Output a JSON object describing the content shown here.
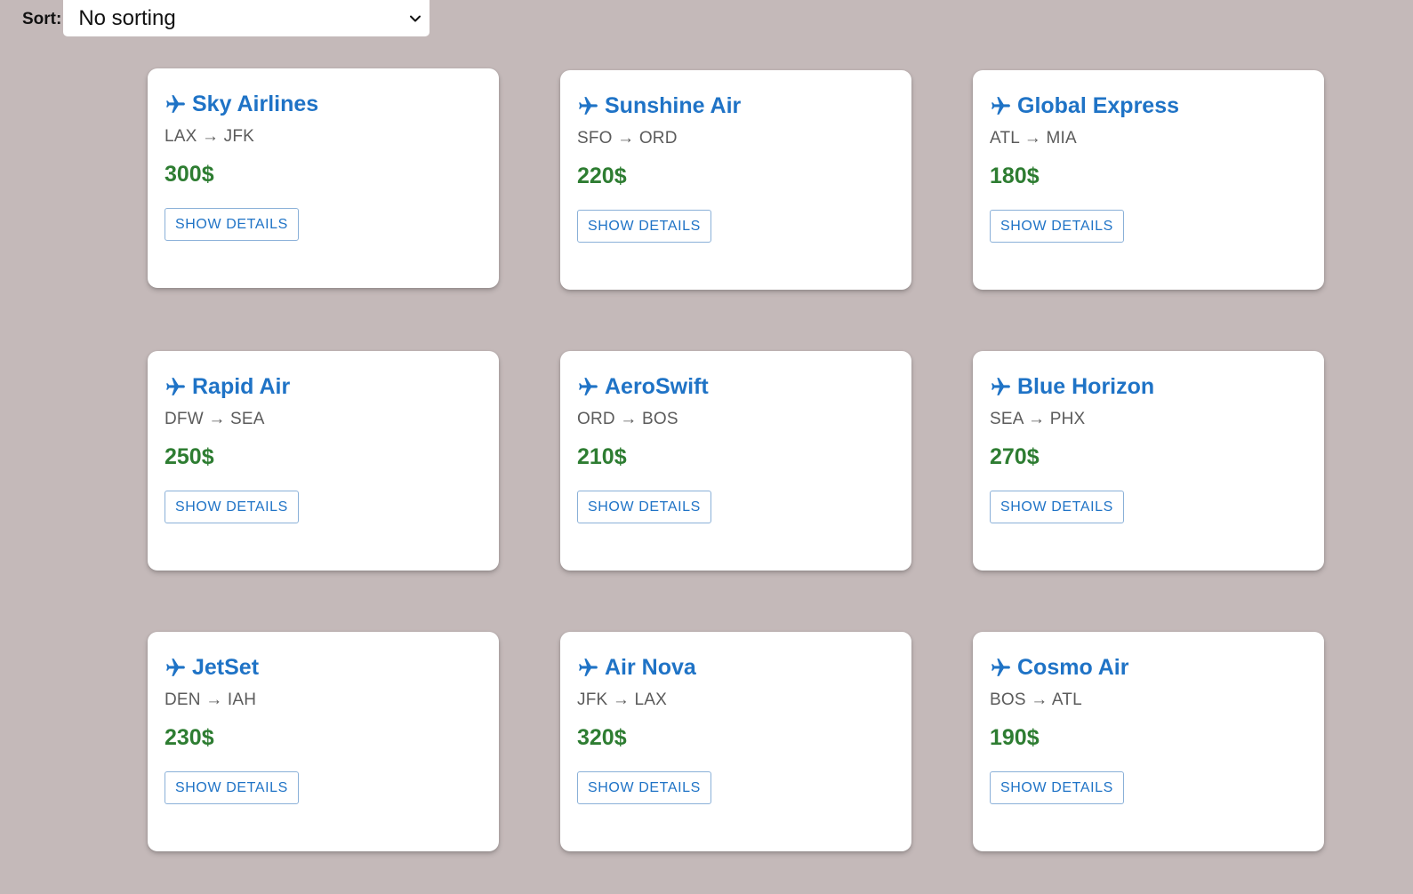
{
  "sort": {
    "label": "Sort:",
    "selected": "No sorting"
  },
  "flights": [
    {
      "airline": "Sky Airlines",
      "route": "LAX → JFK",
      "price": "300$",
      "button": "SHOW DETAILS"
    },
    {
      "airline": "Sunshine Air",
      "route": "SFO → ORD",
      "price": "220$",
      "button": "SHOW DETAILS"
    },
    {
      "airline": "Global Express",
      "route": "ATL → MIA",
      "price": "180$",
      "button": "SHOW DETAILS"
    },
    {
      "airline": "Rapid Air",
      "route": "DFW → SEA",
      "price": "250$",
      "button": "SHOW DETAILS"
    },
    {
      "airline": "AeroSwift",
      "route": "ORD → BOS",
      "price": "210$",
      "button": "SHOW DETAILS"
    },
    {
      "airline": "Blue Horizon",
      "route": "SEA → PHX",
      "price": "270$",
      "button": "SHOW DETAILS"
    },
    {
      "airline": "JetSet",
      "route": "DEN → IAH",
      "price": "230$",
      "button": "SHOW DETAILS"
    },
    {
      "airline": "Air Nova",
      "route": "JFK → LAX",
      "price": "320$",
      "button": "SHOW DETAILS"
    },
    {
      "airline": "Cosmo Air",
      "route": "BOS → ATL",
      "price": "190$",
      "button": "SHOW DETAILS"
    }
  ],
  "icons": {
    "airline": "airplane-icon",
    "select": "chevron-down-icon"
  },
  "colors": {
    "background": "#c4b9b9",
    "airline_title": "#1f73c6",
    "price": "#2e7d32",
    "route": "#5b5b5b"
  }
}
